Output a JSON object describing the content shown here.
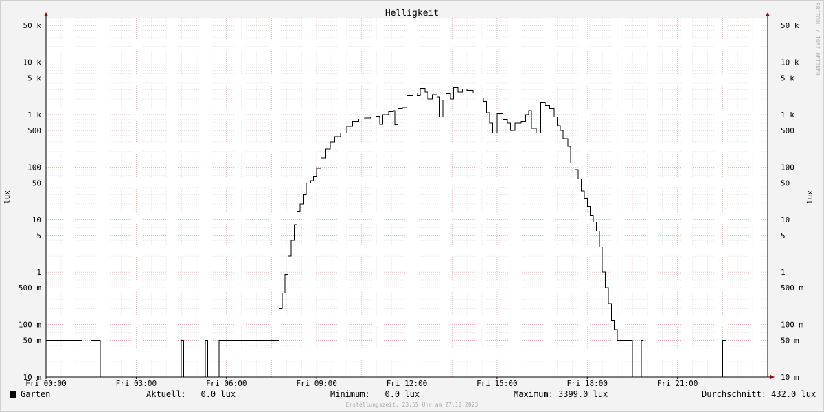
{
  "chart_data": {
    "type": "line",
    "title": "Helligkeit",
    "ylabel": "lux",
    "ylabel_right": "lux",
    "scale": "log",
    "ylim": [
      0.01,
      70000
    ],
    "xlim": [
      0,
      24
    ],
    "grid": true,
    "ytick_values": [
      50000,
      10000,
      5000,
      1000,
      500,
      100,
      50,
      10,
      5,
      1,
      0.5,
      0.1,
      0.05,
      0.01
    ],
    "ytick_labels": [
      "50 k",
      "10 k",
      "5 k",
      "1 k",
      "500",
      "100",
      "50",
      "10",
      "5",
      "1",
      "500 m",
      "100 m",
      "50 m",
      "10 m"
    ],
    "xtick_values": [
      0,
      3,
      6,
      9,
      12,
      15,
      18,
      21
    ],
    "xtick_labels": [
      "Fri 00:00",
      "Fri 03:00",
      "Fri 06:00",
      "Fri 09:00",
      "Fri 12:00",
      "Fri 15:00",
      "Fri 18:00",
      "Fri 21:00"
    ],
    "series": [
      {
        "name": "Garten",
        "color": "#000000",
        "points": [
          [
            0,
            0.05
          ],
          [
            1.2,
            0.05
          ],
          [
            1.2,
            0.01
          ],
          [
            1.5,
            0.01
          ],
          [
            1.5,
            0.05
          ],
          [
            1.8,
            0.05
          ],
          [
            1.8,
            0.01
          ],
          [
            4.5,
            0.01
          ],
          [
            4.5,
            0.05
          ],
          [
            4.58,
            0.05
          ],
          [
            4.58,
            0.01
          ],
          [
            5.3,
            0.01
          ],
          [
            5.3,
            0.05
          ],
          [
            5.38,
            0.05
          ],
          [
            5.38,
            0.01
          ],
          [
            5.75,
            0.01
          ],
          [
            5.75,
            0.05
          ],
          [
            7.7,
            0.05
          ],
          [
            7.75,
            0.2
          ],
          [
            7.85,
            0.4
          ],
          [
            7.95,
            0.9
          ],
          [
            8.05,
            2
          ],
          [
            8.15,
            4
          ],
          [
            8.25,
            8
          ],
          [
            8.35,
            14
          ],
          [
            8.45,
            20
          ],
          [
            8.55,
            30
          ],
          [
            8.65,
            50
          ],
          [
            8.8,
            55
          ],
          [
            8.9,
            65
          ],
          [
            9.0,
            95
          ],
          [
            9.15,
            150
          ],
          [
            9.3,
            220
          ],
          [
            9.45,
            300
          ],
          [
            9.6,
            380
          ],
          [
            9.8,
            450
          ],
          [
            10.0,
            600
          ],
          [
            10.2,
            750
          ],
          [
            10.4,
            820
          ],
          [
            10.6,
            860
          ],
          [
            10.8,
            900
          ],
          [
            11.0,
            920
          ],
          [
            11.1,
            660
          ],
          [
            11.2,
            1000
          ],
          [
            11.4,
            1150
          ],
          [
            11.55,
            1200
          ],
          [
            11.6,
            650
          ],
          [
            11.7,
            1300
          ],
          [
            11.85,
            1350
          ],
          [
            12.0,
            2300
          ],
          [
            12.2,
            2600
          ],
          [
            12.35,
            2300
          ],
          [
            12.45,
            3200
          ],
          [
            12.6,
            2700
          ],
          [
            12.7,
            2000
          ],
          [
            12.85,
            2400
          ],
          [
            13.0,
            2200
          ],
          [
            13.1,
            900
          ],
          [
            13.2,
            1900
          ],
          [
            13.3,
            2500
          ],
          [
            13.45,
            2000
          ],
          [
            13.55,
            3300
          ],
          [
            13.7,
            2700
          ],
          [
            13.85,
            3100
          ],
          [
            14.0,
            2900
          ],
          [
            14.2,
            2600
          ],
          [
            14.4,
            2100
          ],
          [
            14.55,
            1800
          ],
          [
            14.65,
            1100
          ],
          [
            14.75,
            700
          ],
          [
            14.85,
            450
          ],
          [
            15.0,
            1050
          ],
          [
            15.2,
            800
          ],
          [
            15.35,
            700
          ],
          [
            15.45,
            500
          ],
          [
            15.6,
            700
          ],
          [
            15.8,
            750
          ],
          [
            15.95,
            1000
          ],
          [
            16.05,
            1200
          ],
          [
            16.15,
            550
          ],
          [
            16.3,
            450
          ],
          [
            16.45,
            1700
          ],
          [
            16.6,
            1500
          ],
          [
            16.75,
            1300
          ],
          [
            16.9,
            900
          ],
          [
            17.0,
            620
          ],
          [
            17.1,
            500
          ],
          [
            17.2,
            350
          ],
          [
            17.35,
            250
          ],
          [
            17.45,
            120
          ],
          [
            17.6,
            90
          ],
          [
            17.7,
            60
          ],
          [
            17.8,
            35
          ],
          [
            17.9,
            25
          ],
          [
            18.0,
            18
          ],
          [
            18.1,
            12
          ],
          [
            18.2,
            9
          ],
          [
            18.3,
            6
          ],
          [
            18.4,
            3
          ],
          [
            18.5,
            1
          ],
          [
            18.6,
            0.5
          ],
          [
            18.7,
            0.25
          ],
          [
            18.8,
            0.12
          ],
          [
            18.9,
            0.08
          ],
          [
            19.0,
            0.05
          ],
          [
            19.5,
            0.05
          ],
          [
            19.5,
            0.01
          ],
          [
            19.8,
            0.01
          ],
          [
            19.8,
            0.05
          ],
          [
            19.86,
            0.05
          ],
          [
            19.86,
            0.01
          ],
          [
            22.5,
            0.01
          ],
          [
            22.5,
            0.05
          ],
          [
            22.62,
            0.05
          ],
          [
            22.62,
            0.01
          ],
          [
            24,
            0.01
          ]
        ]
      }
    ]
  },
  "legend": {
    "series_name": "Garten",
    "aktuell": "Aktuell:   0.0 lux",
    "minimum": "Minimum:   0.0 lux",
    "maximum": "Maximum: 3399.0 lux",
    "durchschnitt": "Durchschnitt: 432.0 lux"
  },
  "footer": "Erstellungszeit: 23:55 Uhr am 27.10.2023",
  "watermark": "RRDTOOL / TOBI OETIKER"
}
